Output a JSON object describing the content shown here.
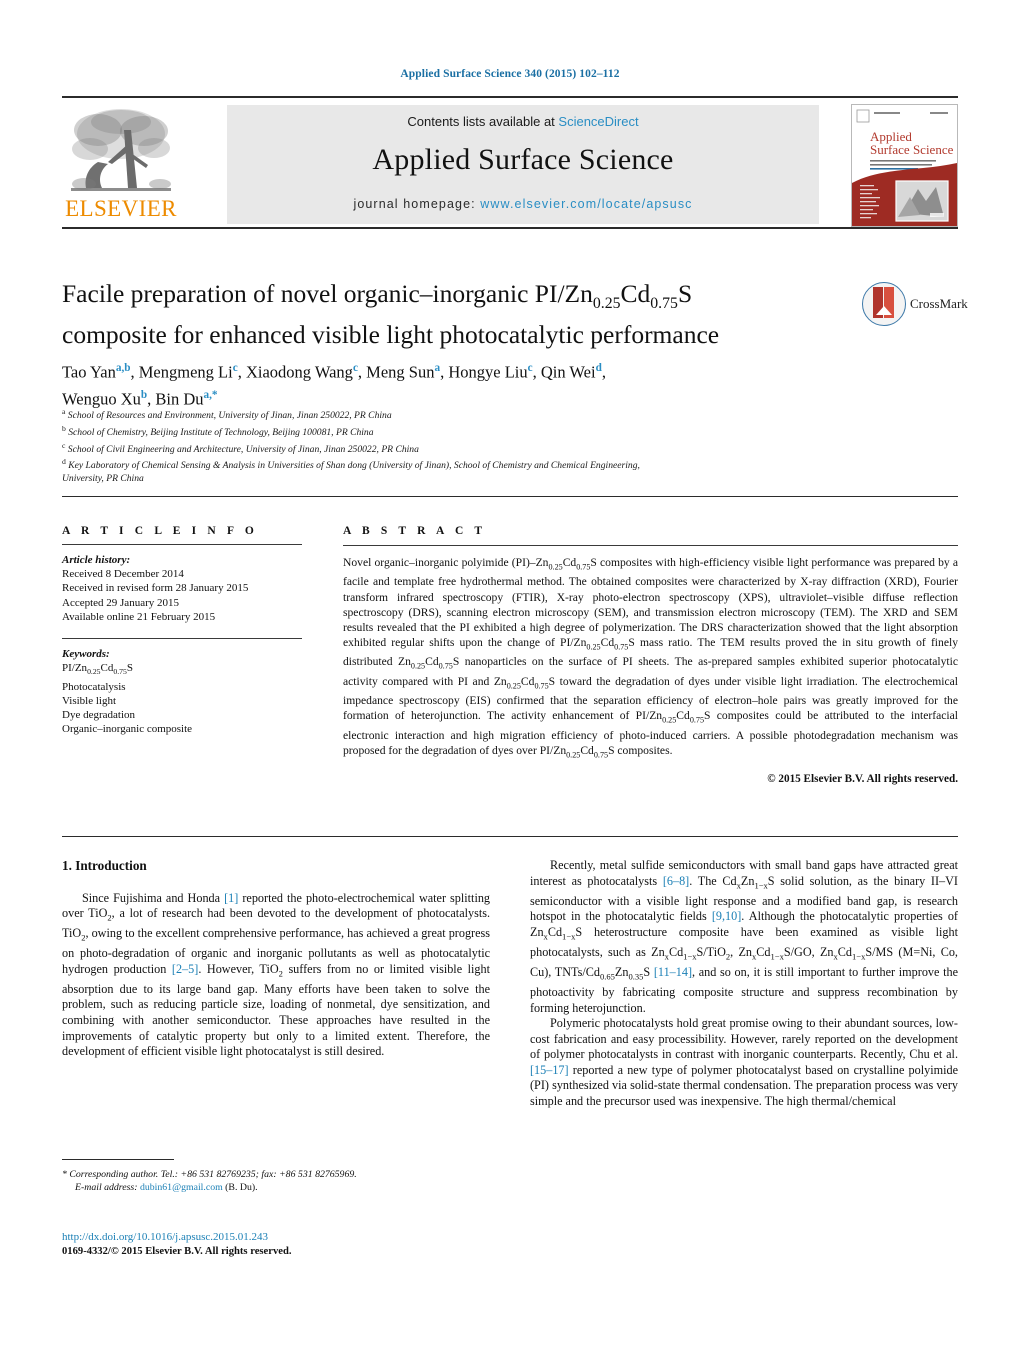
{
  "running_head": "Applied Surface Science 340 (2015) 102–112",
  "masthead": {
    "publisher": "ELSEVIER",
    "contents_prefix": "Contents lists available at ",
    "contents_link": "ScienceDirect",
    "journal_title": "Applied Surface Science",
    "homepage_prefix": "journal homepage: ",
    "homepage_url": "www.elsevier.com/locate/apsusc",
    "cover": {
      "title_line1": "Applied",
      "title_line2": "Surface Science"
    }
  },
  "crossmark": {
    "label": "CrossMark"
  },
  "article": {
    "title_line1": "Facile preparation of novel organic–inorganic PI/Zn0.25Cd0.75S",
    "title_line2": "composite for enhanced visible light photocatalytic performance",
    "authors": "Tao Yan a,b, Mengmeng Li c, Xiaodong Wang c, Meng Sun a, Hongye Liu c, Qin Wei d, Wenguo Xu b, Bin Du a,*",
    "affiliations": [
      "a School of Resources and Environment, University of Jinan, Jinan 250022, PR China",
      "b School of Chemistry, Beijing Institute of Technology, Beijing 100081, PR China",
      "c School of Civil Engineering and Architecture, University of Jinan, Jinan 250022, PR China",
      "d Key Laboratory of Chemical Sensing & Analysis in Universities of Shan dong (University of Jinan), School of Chemistry and Chemical Engineering, University, PR China"
    ]
  },
  "article_info": {
    "heading": "A R T I C L E   I N F O",
    "history_label": "Article history:",
    "history": [
      "Received 8 December 2014",
      "Received in revised form 28 January 2015",
      "Accepted 29 January 2015",
      "Available online 21 February 2015"
    ],
    "keywords_label": "Keywords:",
    "keywords": [
      "PI/Zn0.25Cd0.75S",
      "Photocatalysis",
      "Visible light",
      "Dye degradation",
      "Organic–inorganic composite"
    ]
  },
  "abstract": {
    "heading": "A B S T R A C T",
    "text": "Novel organic–inorganic polyimide (PI)–Zn0.25Cd0.75S composites with high-efficiency visible light performance was prepared by a facile and template free hydrothermal method. The obtained composites were characterized by X-ray diffraction (XRD), Fourier transform infrared spectroscopy (FTIR), X-ray photo-electron spectroscopy (XPS), ultraviolet–visible diffuse reflection spectroscopy (DRS), scanning electron microscopy (SEM), and transmission electron microscopy (TEM). The XRD and SEM results revealed that the PI exhibited a high degree of polymerization. The DRS characterization showed that the light absorption exhibited regular shifts upon the change of PI/Zn0.25Cd0.75S mass ratio. The TEM results proved the in situ growth of finely distributed Zn0.25Cd0.75S nanoparticles on the surface of PI sheets. The as-prepared samples exhibited superior photocatalytic activity compared with PI and Zn0.25Cd0.75S toward the degradation of dyes under visible light irradiation. The electrochemical impedance spectroscopy (EIS) confirmed that the separation efficiency of electron–hole pairs was greatly improved for the formation of heterojunction. The activity enhancement of PI/Zn0.25Cd0.75S composites could be attributed to the interfacial electronic interaction and high migration efficiency of photo-induced carriers. A possible photodegradation mechanism was proposed for the degradation of dyes over PI/Zn0.25Cd0.75S composites.",
    "copyright": "© 2015 Elsevier B.V. All rights reserved."
  },
  "body": {
    "section_heading": "1.  Introduction",
    "left_paragraphs": [
      "Since Fujishima and Honda [1] reported the photo-electrochemical water splitting over TiO2, a lot of research had been devoted to the development of photocatalysts. TiO2, owing to the excellent comprehensive performance, has achieved a great progress on photo-degradation of organic and inorganic pollutants as well as photocatalytic hydrogen production [2–5]. However, TiO2 suffers from no or limited visible light absorption due to its large band gap. Many efforts have been taken to solve the problem, such as reducing particle size, loading of nonmetal, dye sensitization, and combining with another semiconductor. These approaches have resulted in the improvements of catalytic property but only to a limited extent. Therefore, the development of efficient visible light photocatalyst is still desired."
    ],
    "right_paragraphs": [
      "Recently, metal sulfide semiconductors with small band gaps have attracted great interest as photocatalysts [6–8]. The CdxZn1−xS solid solution, as the binary II–VI semiconductor with a visible light response and a modified band gap, is research hotspot in the photocatalytic fields [9,10]. Although the photocatalytic properties of ZnxCd1−xS heterostructure composite have been examined as visible light photocatalysts, such as ZnxCd1−xS/TiO2, ZnxCd1−xS/GO, ZnxCd1−xS/MS (M=Ni, Co, Cu), TNTs/Cd0.65Zn0.35S [11–14], and so on, it is still important to further improve the photoactivity by fabricating composite structure and suppress recombination by forming heterojunction.",
      "Polymeric photocatalysts hold great promise owing to their abundant sources, low-cost fabrication and easy processibility. However, rarely reported on the development of polymer photocatalysts in contrast with inorganic counterparts. Recently, Chu et al. [15–17] reported a new type of polymer photocatalyst based on crystalline polyimide (PI) synthesized via solid-state thermal condensation. The preparation process was very simple and the precursor used was inexpensive. The high thermal/chemical"
    ]
  },
  "footnote": {
    "corresponding": "* Corresponding author. Tel.: +86 531 82769235; fax: +86 531 82765969.",
    "email_label": "E-mail address:",
    "email": "dubin61@gmail.com",
    "email_suffix": "(B. Du)."
  },
  "footer": {
    "doi": "http://dx.doi.org/10.1016/j.apsusc.2015.01.243",
    "issn": "0169-4332/© 2015 Elsevier B.V. All rights reserved."
  },
  "colors": {
    "link": "#1a7fb5",
    "masthead_link": "#2a8ec4",
    "elsevier_orange": "#ed8b00",
    "crossmark_red": "#c0392b"
  }
}
